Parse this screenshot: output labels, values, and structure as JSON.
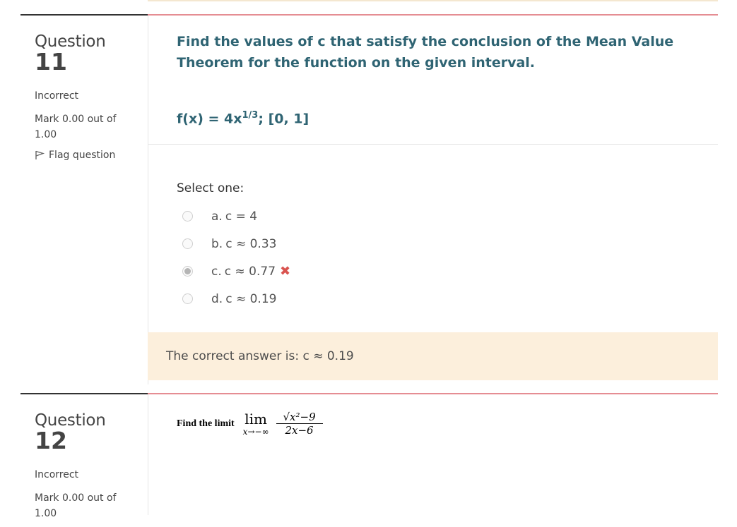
{
  "questions": [
    {
      "label": "Question",
      "number": "11",
      "state": "Incorrect",
      "grade": "Mark 0.00 out of 1.00",
      "flag_label": "Flag question",
      "text": "Find the values of c that satisfy the conclusion of the Mean Value Theorem for the function on the given interval.",
      "function_base": "f(x) = 4x",
      "function_exp": "1/3",
      "function_tail": "; [0, 1]",
      "prompt": "Select one:",
      "options": [
        {
          "letter": "a.",
          "text": "c = 4",
          "checked": false
        },
        {
          "letter": "b.",
          "text": "c ≈ 0.33",
          "checked": false
        },
        {
          "letter": "c.",
          "text": "c ≈ 0.77",
          "checked": true,
          "incorrect_mark": "✖"
        },
        {
          "letter": "d.",
          "text": "c ≈ 0.19",
          "checked": false
        }
      ],
      "feedback": "The correct answer is: c ≈ 0.19"
    },
    {
      "label": "Question",
      "number": "12",
      "state": "Incorrect",
      "grade": "Mark 0.00 out of 1.00",
      "text_label": "Find the limit",
      "lim_word": "lim",
      "lim_sub": "x→−∞",
      "numerator": "√x²−9",
      "denominator": "2x−6"
    }
  ],
  "colors": {
    "question_text": "#2f6473",
    "feedback_bg": "#fcefdc",
    "content_border": "#e58d93",
    "incorrect_mark": "#d9534f"
  }
}
